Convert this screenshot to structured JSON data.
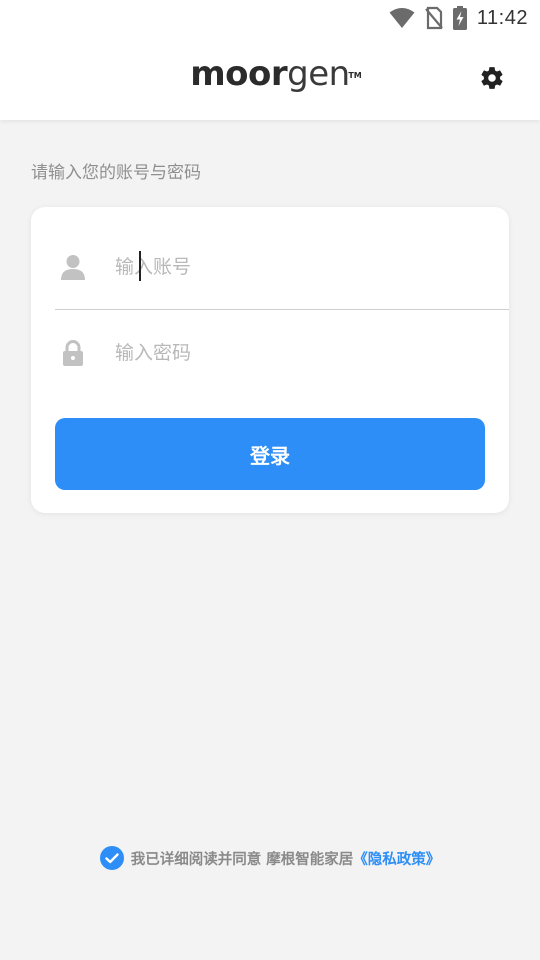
{
  "status_bar": {
    "time": "11:42",
    "icons": [
      "wifi-icon",
      "no-sim-icon",
      "battery-charging-icon"
    ]
  },
  "header": {
    "logo_bold": "moor",
    "logo_light": "gen",
    "logo_tm": "TM",
    "settings_icon": "gear-icon"
  },
  "login": {
    "hint": "请输入您的账号与密码",
    "account": {
      "icon": "user-icon",
      "placeholder": "输入账号",
      "value": ""
    },
    "password": {
      "icon": "lock-icon",
      "placeholder": "输入密码",
      "value": ""
    },
    "submit_label": "登录"
  },
  "agreement": {
    "checked": true,
    "text": "我已详细阅读并同意",
    "company": "摩根智能家居",
    "policy_link": "《隐私政策》"
  },
  "colors": {
    "accent": "#2d8ef7",
    "background": "#f3f3f3",
    "card": "#ffffff",
    "hint_text": "#8f8f8f",
    "placeholder": "#b8b8b8"
  }
}
